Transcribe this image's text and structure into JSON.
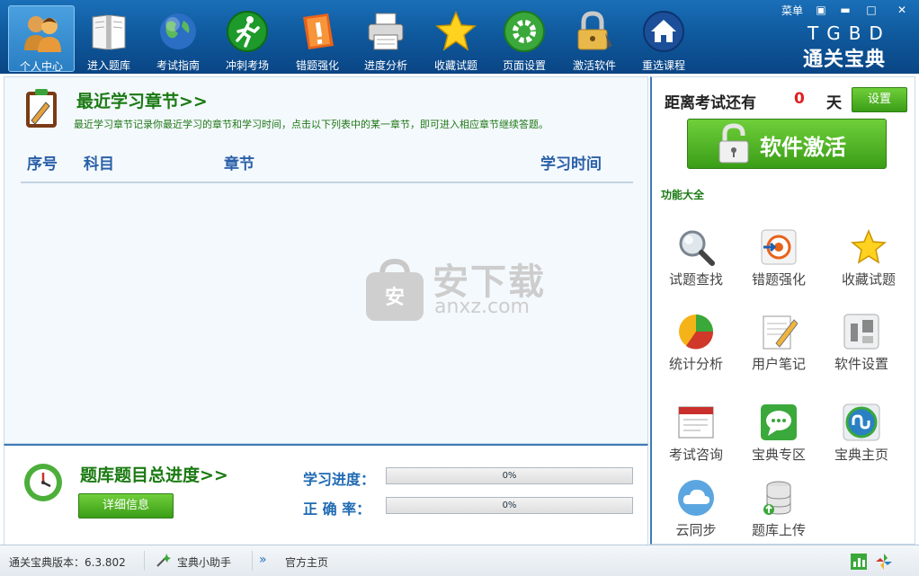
{
  "toolbar": {
    "items": [
      {
        "label": "个人中心",
        "icon": "people-icon"
      },
      {
        "label": "进入题库",
        "icon": "book-icon"
      },
      {
        "label": "考试指南",
        "icon": "globe-icon"
      },
      {
        "label": "冲刺考场",
        "icon": "runner-icon"
      },
      {
        "label": "错题强化",
        "icon": "alert-icon"
      },
      {
        "label": "进度分析",
        "icon": "printer-icon"
      },
      {
        "label": "收藏试题",
        "icon": "star-icon"
      },
      {
        "label": "页面设置",
        "icon": "gear-icon"
      },
      {
        "label": "激活软件",
        "icon": "lock-key-icon"
      },
      {
        "label": "重选课程",
        "icon": "home-icon"
      }
    ],
    "active_index": 0
  },
  "window": {
    "menu_label": "菜单",
    "min_glyph": "▬",
    "max_glyph": "□",
    "close_glyph": "✕",
    "skin_glyph": "▣"
  },
  "logo": {
    "en": "TGBD",
    "cn": "通关宝典"
  },
  "recent": {
    "title": "最近学习章节>>",
    "description": "最近学习章节记录你最近学习的章节和学习时间，点击以下列表中的某一章节，即可进入相应章节继续答题。",
    "columns": [
      "序号",
      "科目",
      "章节",
      "学习时间"
    ],
    "watermark": {
      "cn": "安下载",
      "url": "anxz.com",
      "badge": "安"
    }
  },
  "progress": {
    "title": "题库题目总进度>>",
    "detail_button": "详细信息",
    "study_label": "学习进度：",
    "study_value": "0%",
    "study_fraction": 0,
    "accuracy_label": "正 确 率：",
    "accuracy_value": "0%",
    "accuracy_fraction": 0
  },
  "countdown": {
    "prefix": "距离考试还有",
    "days": "0",
    "unit": "天",
    "settings_button": "设置"
  },
  "activate": {
    "label": "软件激活"
  },
  "features": {
    "heading": "功能大全",
    "items": [
      {
        "label": "试题查找",
        "icon": "magnifier-icon"
      },
      {
        "label": "错题强化",
        "icon": "target-icon"
      },
      {
        "label": "收藏试题",
        "icon": "star-icon"
      },
      {
        "label": "统计分析",
        "icon": "pie-chart-icon"
      },
      {
        "label": "用户笔记",
        "icon": "notepad-pencil-icon"
      },
      {
        "label": "软件设置",
        "icon": "settings-icon"
      },
      {
        "label": "考试咨询",
        "icon": "window-icon"
      },
      {
        "label": "宝典专区",
        "icon": "chat-bubble-icon"
      },
      {
        "label": "宝典主页",
        "icon": "stumbleupon-icon"
      },
      {
        "label": "云同步",
        "icon": "cloud-icon"
      },
      {
        "label": "题库上传",
        "icon": "database-upload-icon"
      }
    ]
  },
  "statusbar": {
    "version": "通关宝典版本：6.3.802",
    "assistant": "宝典小助手",
    "homepage": "官方主页",
    "chevron": "»"
  },
  "colors": {
    "toolbar_blue": "#0f5a9e",
    "title_green": "#1a7a12",
    "accent_green": "#4fb423",
    "days_red": "#e02020"
  }
}
